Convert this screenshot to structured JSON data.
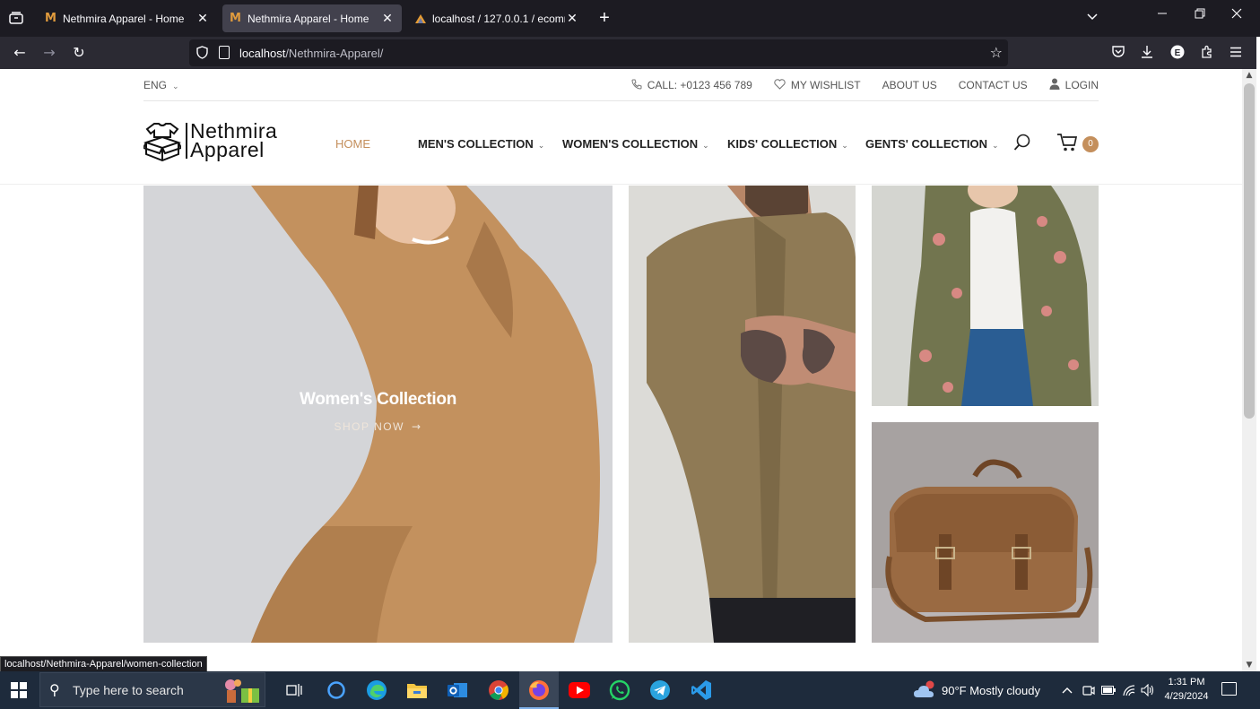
{
  "browser": {
    "tabs": [
      {
        "title": "Nethmira Apparel - Home",
        "active": false
      },
      {
        "title": "Nethmira Apparel - Home",
        "active": true
      },
      {
        "title": "localhost / 127.0.0.1 / ecommer",
        "active": false
      }
    ],
    "url_host": "localhost",
    "url_path": "/Nethmira-Apparel/"
  },
  "site": {
    "language": "ENG",
    "topbar": {
      "call": "CALL: +0123 456 789",
      "wishlist": "MY WISHLIST",
      "about": "ABOUT US",
      "contact": "CONTACT US",
      "login": "LOGIN"
    },
    "logo": {
      "line1": "Nethmira",
      "line2": "Apparel"
    },
    "nav": {
      "home": "HOME",
      "men": "MEN'S COLLECTION",
      "women": "WOMEN'S COLLECTION",
      "kids": "KIDS' COLLECTION",
      "gents": "GENTS' COLLECTION"
    },
    "cart_count": "0",
    "banner": {
      "title": "Women's Collection",
      "cta": "SHOP NOW"
    },
    "accent_color": "#c48f5c"
  },
  "status_url": "localhost/Nethmira-Apparel/women-collection",
  "taskbar": {
    "search_placeholder": "Type here to search",
    "weather": "90°F  Mostly cloudy",
    "time": "1:31 PM",
    "date": "4/29/2024"
  }
}
